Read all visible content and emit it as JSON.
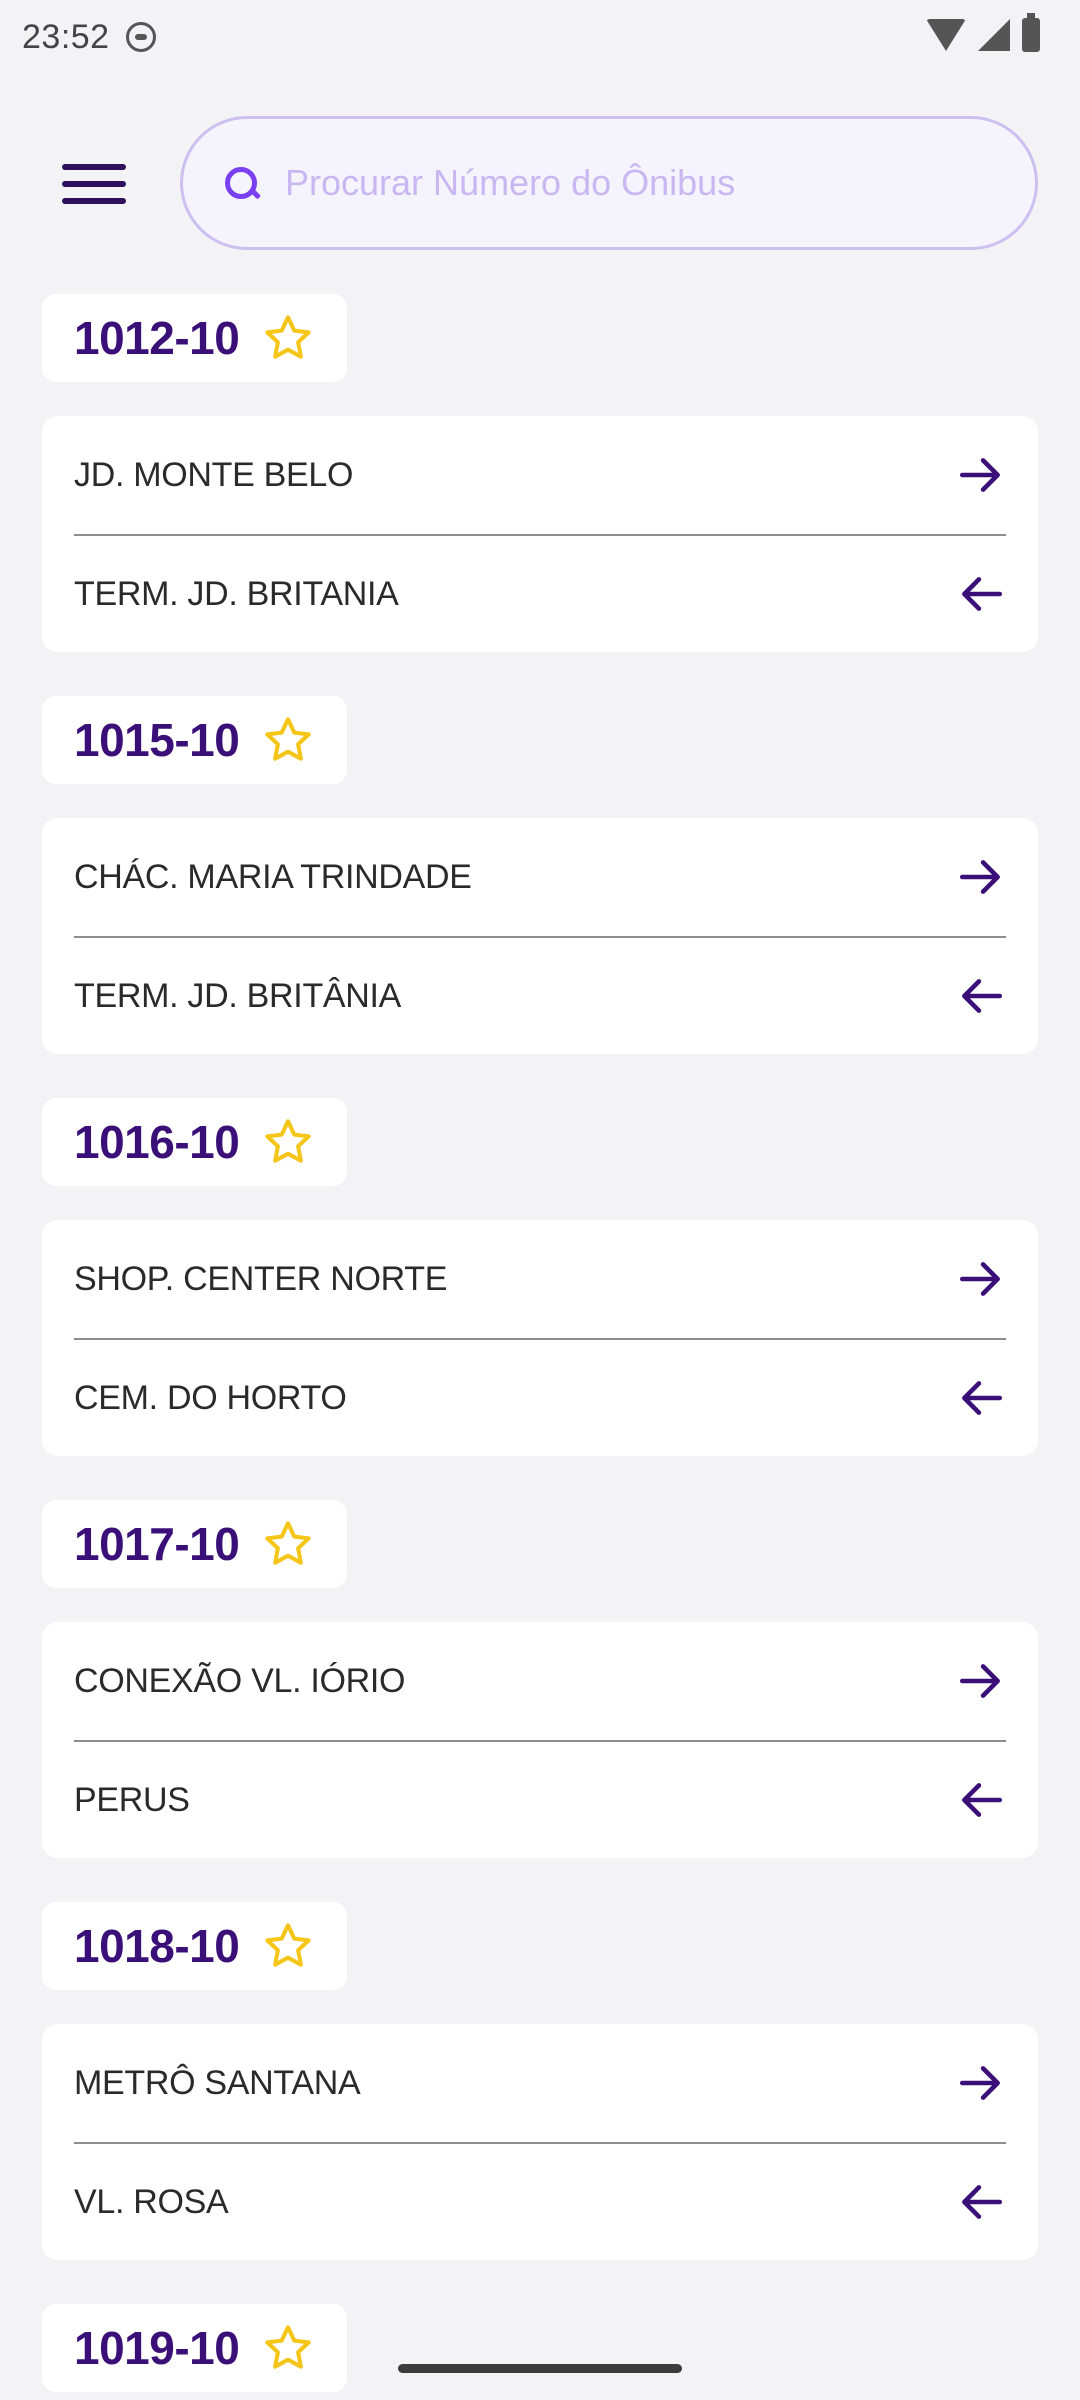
{
  "status_bar": {
    "time": "23:52"
  },
  "search": {
    "placeholder": "Procurar Número do Ônibus"
  },
  "lines": [
    {
      "number": "1012-10",
      "destinations": [
        "JD. MONTE BELO",
        "TERM. JD. BRITANIA"
      ]
    },
    {
      "number": "1015-10",
      "destinations": [
        "CHÁC. MARIA TRINDADE",
        "TERM. JD. BRITÂNIA"
      ]
    },
    {
      "number": "1016-10",
      "destinations": [
        "SHOP. CENTER NORTE",
        "CEM. DO HORTO"
      ]
    },
    {
      "number": "1017-10",
      "destinations": [
        "CONEXÃO VL. IÓRIO",
        "PERUS"
      ]
    },
    {
      "number": "1018-10",
      "destinations": [
        "METRÔ SANTANA",
        "VL. ROSA"
      ]
    },
    {
      "number": "1019-10",
      "destinations": [
        "",
        ""
      ]
    }
  ],
  "colors": {
    "accent": "#3a1078",
    "star": "#f5c518",
    "search_icon": "#7b3ff2",
    "background": "#f3f3f6"
  },
  "icons": {
    "menu": "hamburger-icon",
    "search": "search-icon",
    "favorite": "star-outline-icon",
    "forward": "arrow-right-icon",
    "back": "arrow-left-icon"
  }
}
